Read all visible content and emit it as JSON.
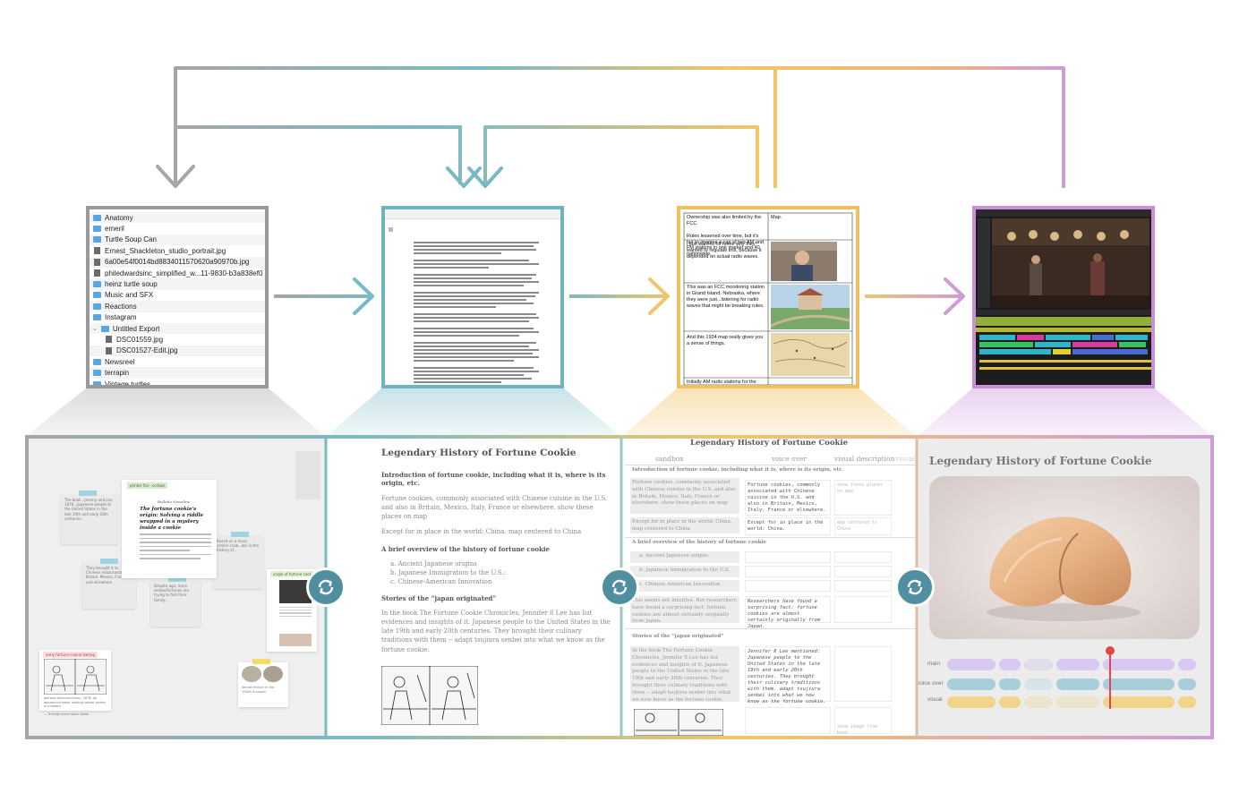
{
  "colors": {
    "files": "#9a9a9a",
    "doc": "#6fb3bf",
    "table": "#f0c060",
    "video": "#c990d6",
    "sync": "#4f8f9f"
  },
  "files_thumb": {
    "items": [
      {
        "label": "Anatomy",
        "kind": "folder"
      },
      {
        "label": "emeril",
        "kind": "folder"
      },
      {
        "label": "Turtle Soup Can",
        "kind": "folder"
      },
      {
        "label": "Ernest_Shackleton_studio_portrait.jpg",
        "kind": "image"
      },
      {
        "label": "6a00e54f0014bd8834011570620a90970b.jpg",
        "kind": "image"
      },
      {
        "label": "philedwardsinc_simplified_w...11-9830-b3a838ef0",
        "kind": "image"
      },
      {
        "label": "heinz turtle soup",
        "kind": "folder"
      },
      {
        "label": "Music and SFX",
        "kind": "folder"
      },
      {
        "label": "Reactions",
        "kind": "folder"
      },
      {
        "label": "Instagram",
        "kind": "folder"
      },
      {
        "label": "Untitled Export",
        "kind": "folder-open"
      },
      {
        "label": "DSC01559.jpg",
        "kind": "image-sub"
      },
      {
        "label": "DSC01527-Edit.jpg",
        "kind": "image-sub"
      },
      {
        "label": "Newsreel",
        "kind": "folder"
      },
      {
        "label": "terrapin",
        "kind": "folder"
      },
      {
        "label": "Vintage turtles",
        "kind": "folder"
      }
    ]
  },
  "table_thumb": {
    "rows": [
      {
        "left": "Ownership was also limited by the FCC.\n\nRules lessened over time, but it's fair to imagine a cap of two AM and FM stations in one market and 40 nationwide.",
        "right": "Map."
      },
      {
        "left": "I just want to hit home why they wanted to regulate this, because it depended on actual radio waves.",
        "right": ""
      },
      {
        "left": "This was an FCC monitoring station in Grand Island, Nebraska, where they were just...listening for radio waves that might be breaking rules.",
        "right": ""
      },
      {
        "left": "And this 1934 map really gives you a sense of things.",
        "right": ""
      },
      {
        "left": "Initially AM radio stations for the course of",
        "right": ""
      }
    ]
  },
  "sandbox": {
    "doc_tag": "printer fan - scribes",
    "doc_headline": "The fortune cookie's origin: Solving a riddle wrapped in a mystery inside a cookie",
    "doc_source": "Bulletin Newsline",
    "origin_tag": "origin of fortune cookie",
    "early_tag": "early fortune cookie baking",
    "early_caption": "...Katherine, translate... stable",
    "notes": [
      "The book...Jeremy and Lee, 1878...Japanese people to the United States in the late 19th and early 20th centuries...",
      "They brought it to Chinese restaurants in Britain, Mexico, France and elsewhere",
      "Despite ago, more senbei/fortunes are trying to find their family...",
      "Based on a more similar crow...bar in the history of...",
      "Senbei history in the 1900s is shown"
    ],
    "early_note": "Jaeheon deconstruction, 1878; an apprentice baker making senbei wafers in a bakery\n\n— Frelinghuysen Kochi Kaido"
  },
  "doc_panel": {
    "title": "Legendary History of Fortune Cookie",
    "intro_heading": "Introduction of fortune cookie, including what it is, where is its origin, etc.",
    "intro_p1": "Fortune cookies, commonly associated with Chinese cuisine in the U.S. and also in Britain, Mexico, Italy, France or elsewhere. show these places on map",
    "intro_p2": "Except for in place in the world: China. map centered to China",
    "overview_heading": "A brief overview of the history of fortune cookie",
    "list": [
      "a.  Ancient Japanese origins",
      "b.  Japanese Immigration to the U.S.:",
      "c.  Chinese-American Innovation"
    ],
    "japan_heading": "Stories of the “japan originated”",
    "japan_p": "In the book The Fortune Cookie Chronicles,  Jennifer 8 Lee has list evidences and insights of it. Japanese people to the United States in the late 19th and early 20th centuries. They  brought their culinary traditions with them -- adapt tsujiura senbei into what we know as the fortune cookie."
  },
  "table_panel": {
    "title": "Legendary History of Fortune Cookie",
    "columns": [
      "sandbox",
      "voice over",
      "visual description",
      "visual"
    ],
    "sec1": "Introduction of fortune cookie, including what it is, where is its origin, etc.",
    "r1_left": "Fortune cookies, commonly associated with Chinese cuisine in the U.S. and also in Britain, Mexico, Italy, France or elsewhere. show these places on map",
    "r1_vo": "Fortune cookies, commonly associated with Chinese cuisine in the U.S. and also in Britain, Mexico, Italy. France or elsewhere.",
    "r1_vd": "show these places on map",
    "r2_left": "Except for in place in the world: China. map centered to China",
    "r2_vo": "Except for in place in the world: China.",
    "r2_vd": "map centered to China",
    "sec2": "A brief overview of the history of fortune cookie",
    "list": [
      "a.  Ancient Japanese origins",
      "b.  Japanese Immigration to the U.S.",
      "c.  Chinese-American Innovation"
    ],
    "r3_left": "This seems not intuitive. But researchers have found a surprising fact: fortune cookies are almost certainly originally from Japan.",
    "r3_vo": "Researchers have found a surprising fact: fortune cookies are almost certainly originally from Japan.",
    "sec3": "Stories of the “japan originated”",
    "r4_left": "In the book The Fortune Cookie Chronicles, Jennifer 8 Lee has list evidences and insights of it. Japanese people to the United States in the late 19th and early 20th centuries. They brought their culinary traditions with them -- adapt tsujiura senbei into what we now know as the fortune cookie.",
    "r4_vo": "Jennifer 8 Lee mentioned: Japanese people to the United States in the late 19th and early 20th centuries. They brought their culinary traditions with them. adapt tsujiura senbei into what we now know as the fortune cookie.",
    "r5_vd": "show image from book"
  },
  "video_panel": {
    "title": "Legendary History of Fortune Cookie",
    "tracks": [
      "main",
      "voice over",
      "visual"
    ],
    "track_colors": {
      "main": "#d8c8f2",
      "voice over": "#a8cfd9",
      "visual": "#f0d58a"
    },
    "playhead_color": "#e04848"
  }
}
